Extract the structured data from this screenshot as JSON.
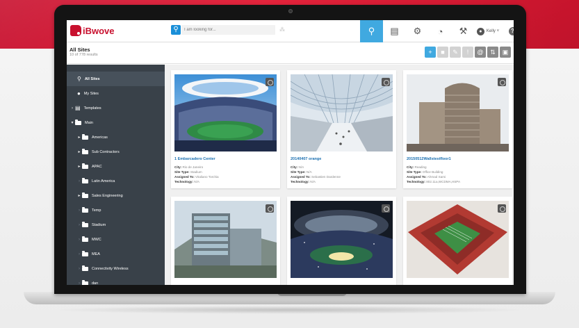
{
  "app": {
    "logo": "iBwove"
  },
  "search": {
    "placeholder": "I am looking for..."
  },
  "user": {
    "name": "Kelly"
  },
  "page": {
    "title": "All Sites",
    "subtitle": "10 of 778 results"
  },
  "sidebar": {
    "items": [
      {
        "label": "All Sites"
      },
      {
        "label": "My Sites"
      },
      {
        "label": "Templates"
      },
      {
        "label": "Main"
      },
      {
        "label": "Americas"
      },
      {
        "label": "Sub Contractors"
      },
      {
        "label": "APAC"
      },
      {
        "label": "Latin America"
      },
      {
        "label": "Sales Engineering"
      },
      {
        "label": "Temp"
      },
      {
        "label": "Stadium"
      },
      {
        "label": "MWC"
      },
      {
        "label": "MEA"
      },
      {
        "label": "Connectivity Wireless"
      },
      {
        "label": "dan"
      }
    ]
  },
  "field_labels": {
    "city": "City:",
    "site_type": "Site Type:",
    "assigned_to": "Assigned To:",
    "technology": "Technology:"
  },
  "cards": [
    {
      "title": "1 Embarcadero Center",
      "city": "Rio de Janeiro",
      "site_type": "Stadium",
      "assigned_to": "Vitaliano Torchia",
      "technology": "N/A"
    },
    {
      "title": "20140407 orange",
      "city": "N/A",
      "site_type": "N/A",
      "assigned_to": "Sebastien Dardenne",
      "technology": "N/A"
    },
    {
      "title": "20150512Wallstestfloor1",
      "city": "Reading",
      "site_type": "Office Building",
      "assigned_to": "Ahmad Sami",
      "technology": "802.11a,WCDMA,HSPA"
    }
  ],
  "colors": {
    "brand_red": "#c8102e",
    "accent_blue": "#40a9e0",
    "sidebar_bg": "#394149",
    "link_blue": "#1a6fb0"
  }
}
